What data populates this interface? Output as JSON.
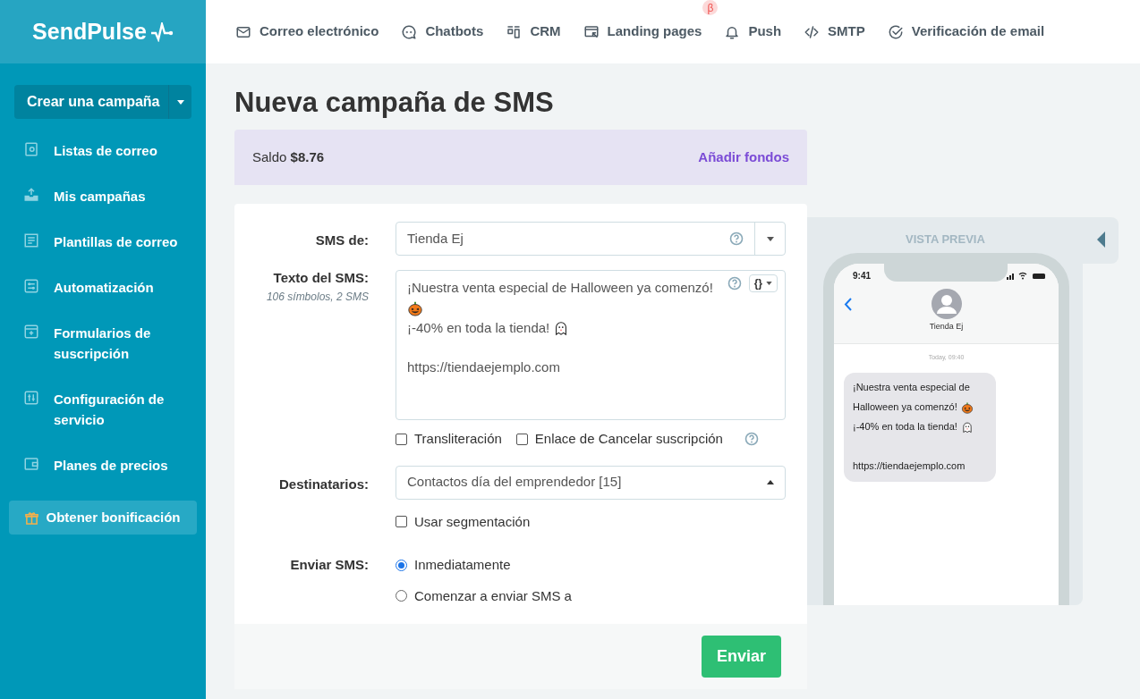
{
  "logo": {
    "text": "SendPulse"
  },
  "top_nav": [
    {
      "label": "Correo electrónico"
    },
    {
      "label": "Chatbots"
    },
    {
      "label": "CRM"
    },
    {
      "label": "Landing pages",
      "badge": "β"
    },
    {
      "label": "Push"
    },
    {
      "label": "SMTP"
    },
    {
      "label": "Verificación de email"
    }
  ],
  "sidebar": {
    "create_button": "Crear una campaña",
    "items": [
      {
        "label": "Listas de correo"
      },
      {
        "label": "Mis campañas"
      },
      {
        "label": "Plantillas de correo"
      },
      {
        "label": "Automatización"
      },
      {
        "label": "Formularios de suscripción"
      },
      {
        "label": "Configuración de servicio"
      },
      {
        "label": "Planes de precios"
      }
    ],
    "bonus_button": "Obtener bonificación"
  },
  "page_title": "Nueva campaña de SMS",
  "balance": {
    "label": "Saldo",
    "amount": "$8.76",
    "link": "Añadir fondos"
  },
  "form": {
    "sender": {
      "label": "SMS de:",
      "value": "Tienda Ej"
    },
    "message": {
      "label": "Texto del SMS:",
      "counter": "106 símbolos, 2 SMS",
      "lines": [
        {
          "kind": "text",
          "text": "¡Nuestra venta especial de Halloween ya comenzó!"
        },
        {
          "kind": "pumpkin"
        },
        {
          "kind": "ghost",
          "text": "¡-40% en toda la tienda!"
        },
        {
          "kind": "blank"
        },
        {
          "kind": "text",
          "text": "https://tiendaejemplo.com"
        }
      ],
      "variables_button": "{}"
    },
    "options": [
      {
        "label": "Transliteración",
        "checked": false
      },
      {
        "label": "Enlace de Cancelar suscripción",
        "checked": false
      }
    ],
    "recipients": {
      "label": "Destinatarios:",
      "value": "Contactos día del emprendedor [15]"
    },
    "segmentation": {
      "label": "Usar segmentación",
      "checked": false
    },
    "send": {
      "label": "Enviar SMS:",
      "choices": [
        {
          "label": "Inmediatamente",
          "selected": true
        },
        {
          "label": "Comenzar a enviar SMS a",
          "selected": false
        }
      ]
    },
    "submit": "Enviar"
  },
  "preview": {
    "title": "VISTA PREVIA",
    "time": "9:41",
    "contact": "Tienda Ej",
    "timestamp": "Today, 09:40",
    "bubble_lines": [
      {
        "kind": "text",
        "text": "¡Nuestra venta especial de"
      },
      {
        "kind": "pumpkin",
        "text": "Halloween ya comenzó!"
      },
      {
        "kind": "ghost",
        "text": "¡-40% en toda la tienda!"
      },
      {
        "kind": "blank"
      },
      {
        "kind": "text",
        "text": "https://tiendaejemplo.com"
      }
    ]
  }
}
